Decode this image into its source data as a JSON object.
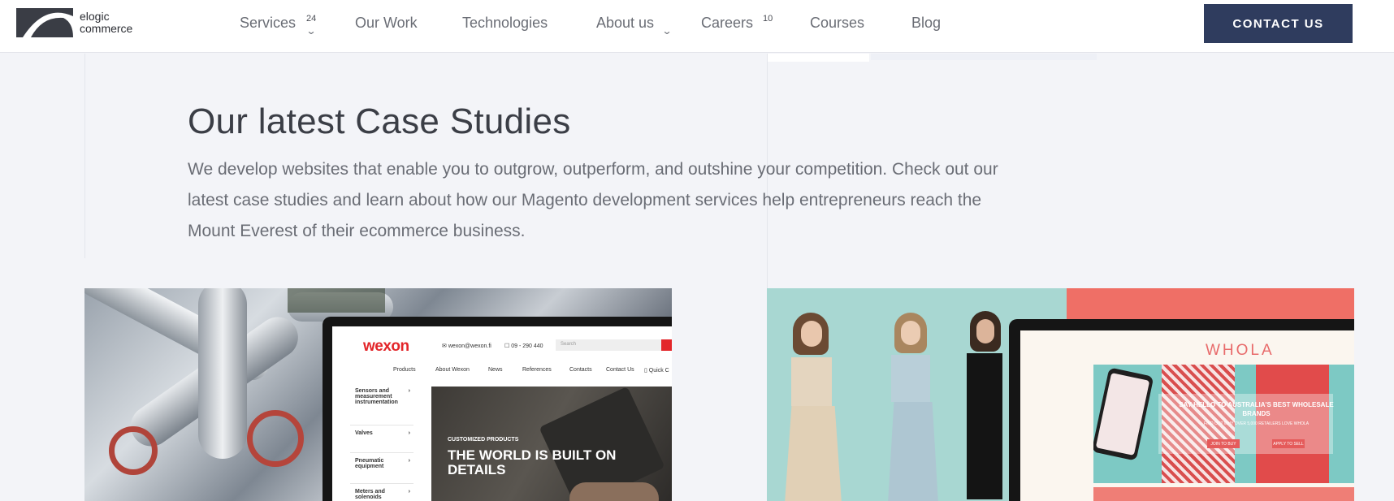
{
  "header": {
    "logo_line1": "elogic",
    "logo_line2": "commerce",
    "nav": [
      {
        "label": "Services",
        "badge": "24",
        "has_dropdown": true
      },
      {
        "label": "Our Work"
      },
      {
        "label": "Technologies"
      },
      {
        "label": "About us",
        "has_dropdown": true
      },
      {
        "label": "Careers",
        "badge": "10"
      },
      {
        "label": "Courses"
      },
      {
        "label": "Blog"
      }
    ],
    "cta_label": "CONTACT US"
  },
  "main": {
    "title": "Our latest Case Studies",
    "intro": "We develop websites that enable you to outgrow, outperform, and outshine your competition. Check out our latest case studies and learn about how our Magento development services help entrepreneurs reach the Mount Everest of their ecommerce business."
  },
  "cases": [
    {
      "brand": "wexon",
      "email": "wexon@wexon.fi",
      "phone": "09 - 290 440",
      "search_placeholder": "Search",
      "menu": [
        "Products",
        "About Wexon",
        "News",
        "References",
        "Contacts",
        "Contact Us",
        "Quick C"
      ],
      "side_menu": [
        "Sensors and measurement instrumentation",
        "Valves",
        "Pneumatic equipment",
        "Meters and solenoids"
      ],
      "kicker": "CUSTOMIZED PRODUCTS",
      "hero_title": "THE WORLD IS BUILT ON DETAILS"
    },
    {
      "brand": "WHOLA",
      "headline": "SAY HELLO TO AUSTRALIA'S BEST WHOLESALE BRANDS",
      "sub": "FIND OUT WHY OVER 5,000 RETAILERS LOVE WHOLA",
      "btn1": "JOIN TO BUY",
      "btn2": "APPLY TO SELL"
    }
  ],
  "colors": {
    "accent": "#2f3c5e",
    "page_bg": "#f3f4f8",
    "wexon_red": "#e3262a",
    "whola_coral": "#ef6f66",
    "whola_teal": "#a8d7d2"
  }
}
